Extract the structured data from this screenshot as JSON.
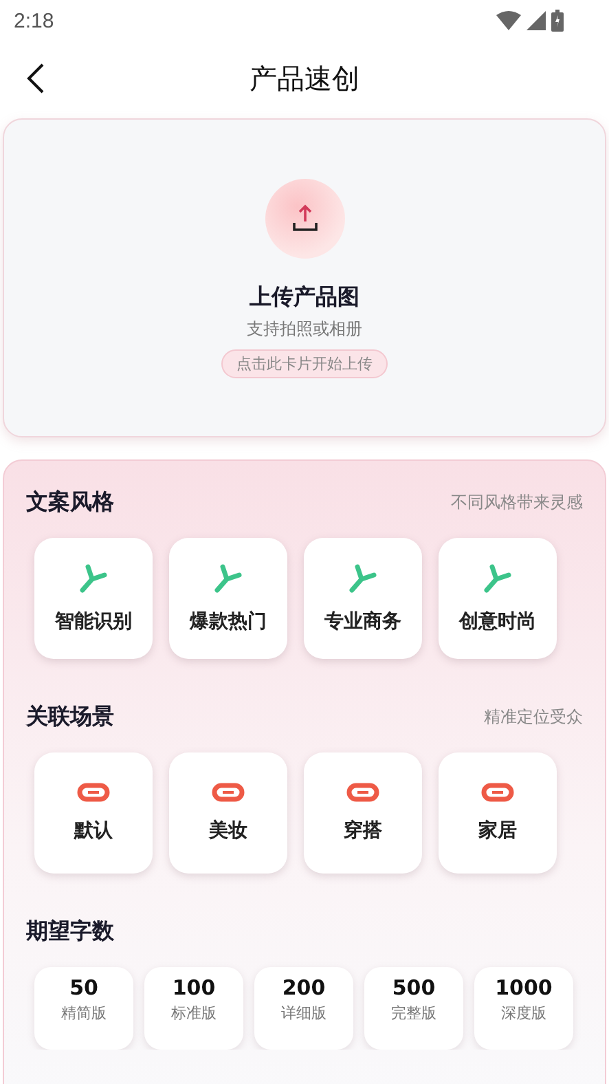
{
  "status_bar": {
    "time": "2:18"
  },
  "header": {
    "title": "产品速创"
  },
  "upload": {
    "title": "上传产品图",
    "subtitle": "支持拍照或相册",
    "hint": "点击此卡片开始上传"
  },
  "sections": [
    {
      "title": "文案风格",
      "note": "不同风格带来灵感",
      "kind": "style",
      "items": [
        {
          "label": "智能识别"
        },
        {
          "label": "爆款热门"
        },
        {
          "label": "专业商务"
        },
        {
          "label": "创意时尚"
        }
      ]
    },
    {
      "title": "关联场景",
      "note": "精准定位受众",
      "kind": "scene",
      "items": [
        {
          "label": "默认"
        },
        {
          "label": "美妆"
        },
        {
          "label": "穿搭"
        },
        {
          "label": "家居"
        }
      ]
    },
    {
      "title": "期望字数",
      "kind": "count",
      "items": [
        {
          "value": "50",
          "label": "精简版"
        },
        {
          "value": "100",
          "label": "标准版"
        },
        {
          "value": "200",
          "label": "详细版"
        },
        {
          "value": "500",
          "label": "完整版"
        },
        {
          "value": "1000",
          "label": "深度版"
        }
      ]
    }
  ]
}
